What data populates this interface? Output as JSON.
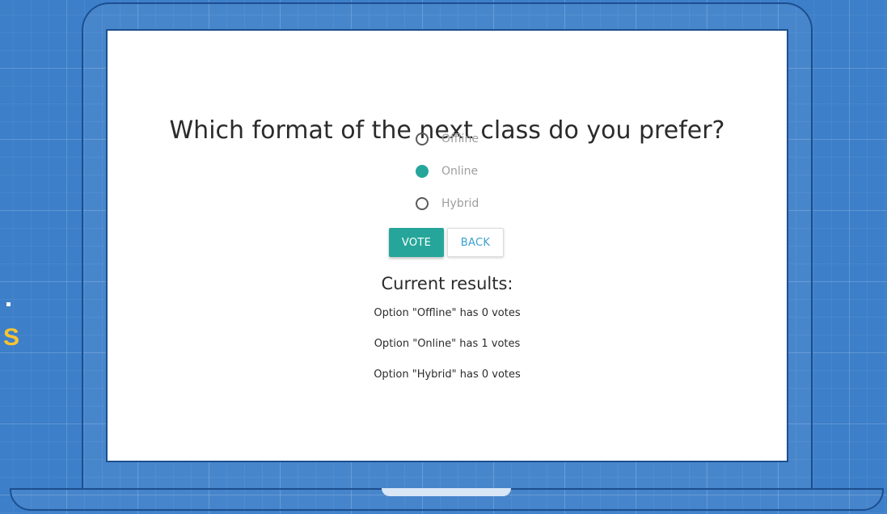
{
  "background": {
    "side_text": "S",
    "accent_color": "#f6c431",
    "grid_color": "#3d7fc9"
  },
  "poll": {
    "question": "Which format of the next class do you prefer?",
    "options": [
      {
        "label": "Offline",
        "selected": false
      },
      {
        "label": "Online",
        "selected": true
      },
      {
        "label": "Hybrid",
        "selected": false
      }
    ],
    "accent_color": "#26a69a"
  },
  "buttons": {
    "vote_label": "VOTE",
    "back_label": "BACK"
  },
  "results": {
    "title": "Current results:",
    "lines": [
      "Option \"Offline\" has 0 votes",
      "Option \"Online\" has 1 votes",
      "Option \"Hybrid\" has 0 votes"
    ]
  }
}
